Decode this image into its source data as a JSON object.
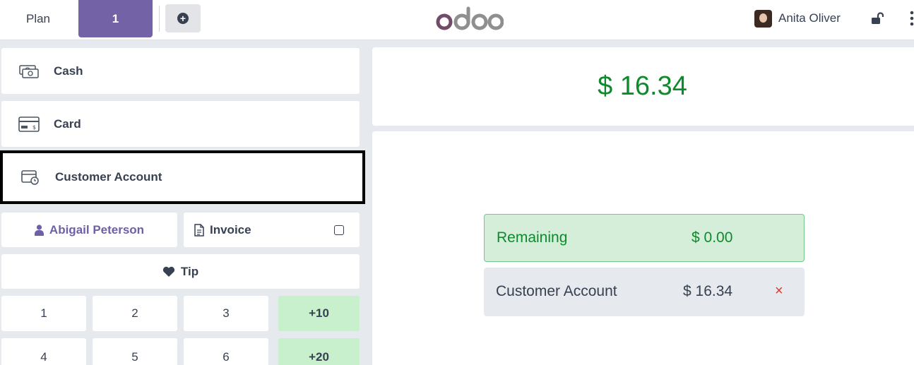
{
  "header": {
    "plan_label": "Plan",
    "table_number": "1",
    "add_order_icon": "plus-circle-icon",
    "logo_text": "odoo",
    "user_name": "Anita Oliver",
    "lock_icon": "unlock-icon",
    "menu_icon": "vertical-ellipsis-icon",
    "accent_color": "#7462a6"
  },
  "payment_methods": [
    {
      "label": "Cash",
      "icon": "cash-icon"
    },
    {
      "label": "Card",
      "icon": "card-icon"
    },
    {
      "label": "Customer Account",
      "icon": "wallet-clock-icon"
    }
  ],
  "actions": {
    "customer_label": "Abigail Peterson",
    "invoice_label": "Invoice",
    "invoice_checked": false,
    "tip_label": "Tip"
  },
  "numpad": {
    "keys": [
      "1",
      "2",
      "3",
      "+10",
      "4",
      "5",
      "6",
      "+20"
    ]
  },
  "summary": {
    "total": "$ 16.34",
    "remaining_label": "Remaining",
    "remaining_value": "$ 0.00",
    "lines": [
      {
        "label": "Customer Account",
        "amount": "$ 16.34",
        "delete_symbol": "×"
      }
    ]
  },
  "colors": {
    "amount_green": "#0e8a2c",
    "remaining_bg": "#d4eeda",
    "quick_add_bg": "#c8f0cc",
    "delete_red": "#d9392e"
  }
}
